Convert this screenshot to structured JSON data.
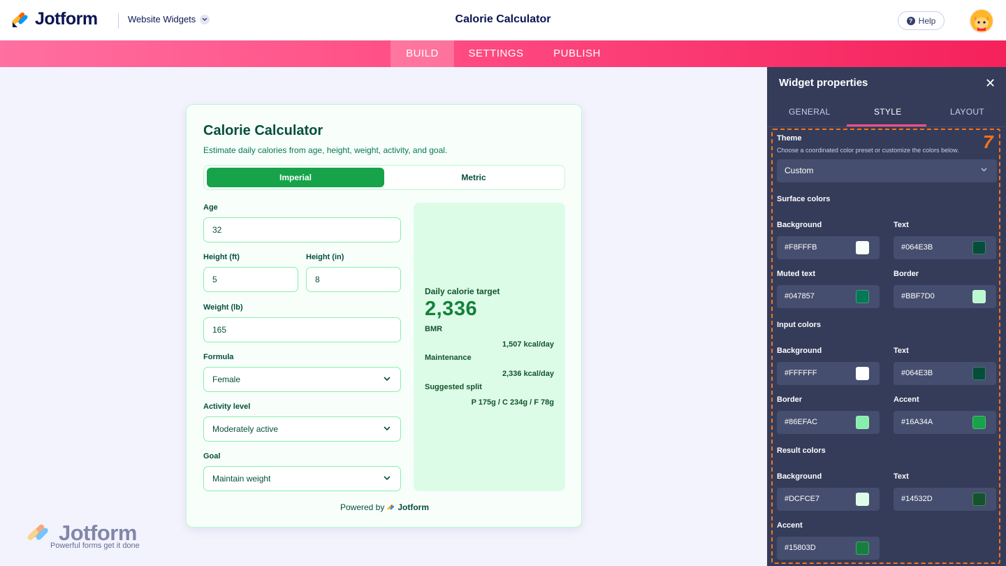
{
  "header": {
    "logo_text": "Jotform",
    "product_switcher": "Website Widgets",
    "title": "Calorie Calculator",
    "help_label": "Help"
  },
  "nav": {
    "tabs": [
      "BUILD",
      "SETTINGS",
      "PUBLISH"
    ],
    "active": "BUILD"
  },
  "widget": {
    "title": "Calorie Calculator",
    "subtitle": "Estimate daily calories from age, height, weight, activity, and goal.",
    "units": [
      "Imperial",
      "Metric"
    ],
    "active_unit": "Imperial",
    "fields": {
      "age": {
        "label": "Age",
        "value": "32"
      },
      "height_ft": {
        "label": "Height (ft)",
        "value": "5"
      },
      "height_in": {
        "label": "Height (in)",
        "value": "8"
      },
      "weight": {
        "label": "Weight (lb)",
        "value": "165"
      },
      "formula": {
        "label": "Formula",
        "value": "Female"
      },
      "activity": {
        "label": "Activity level",
        "value": "Moderately active"
      },
      "goal": {
        "label": "Goal",
        "value": "Maintain weight"
      }
    },
    "result": {
      "target_label": "Daily calorie target",
      "target_value": "2,336",
      "bmr_label": "BMR",
      "bmr_value": "1,507 kcal/day",
      "maintenance_label": "Maintenance",
      "maintenance_value": "2,336 kcal/day",
      "split_label": "Suggested split",
      "split_value": "P 175g / C 234g / F 78g"
    },
    "powered_by": "Powered by",
    "powered_brand": "Jotform"
  },
  "watermark": {
    "word": "Jotform",
    "tagline": "Powerful forms get it done"
  },
  "properties": {
    "title": "Widget properties",
    "tabs": [
      "GENERAL",
      "STYLE",
      "LAYOUT"
    ],
    "active_tab": "STYLE",
    "step_number": "7",
    "theme_label": "Theme",
    "theme_hint": "Choose a coordinated color preset or customize the colors below.",
    "theme_value": "Custom",
    "surface": {
      "heading": "Surface colors",
      "background": {
        "label": "Background",
        "value": "#F8FFFB"
      },
      "text": {
        "label": "Text",
        "value": "#064E3B"
      },
      "muted": {
        "label": "Muted text",
        "value": "#047857"
      },
      "border": {
        "label": "Border",
        "value": "#BBF7D0"
      }
    },
    "input": {
      "heading": "Input colors",
      "background": {
        "label": "Background",
        "value": "#FFFFFF"
      },
      "text": {
        "label": "Text",
        "value": "#064E3B"
      },
      "border": {
        "label": "Border",
        "value": "#86EFAC"
      },
      "accent": {
        "label": "Accent",
        "value": "#16A34A"
      }
    },
    "result": {
      "heading": "Result colors",
      "background": {
        "label": "Background",
        "value": "#DCFCE7"
      },
      "text": {
        "label": "Text",
        "value": "#14532D"
      },
      "accent": {
        "label": "Accent",
        "value": "#15803D"
      }
    }
  },
  "colors": {
    "brand_pink": "#FF4F86",
    "panel_dark": "#343C5A",
    "highlight_orange": "#F97316"
  }
}
